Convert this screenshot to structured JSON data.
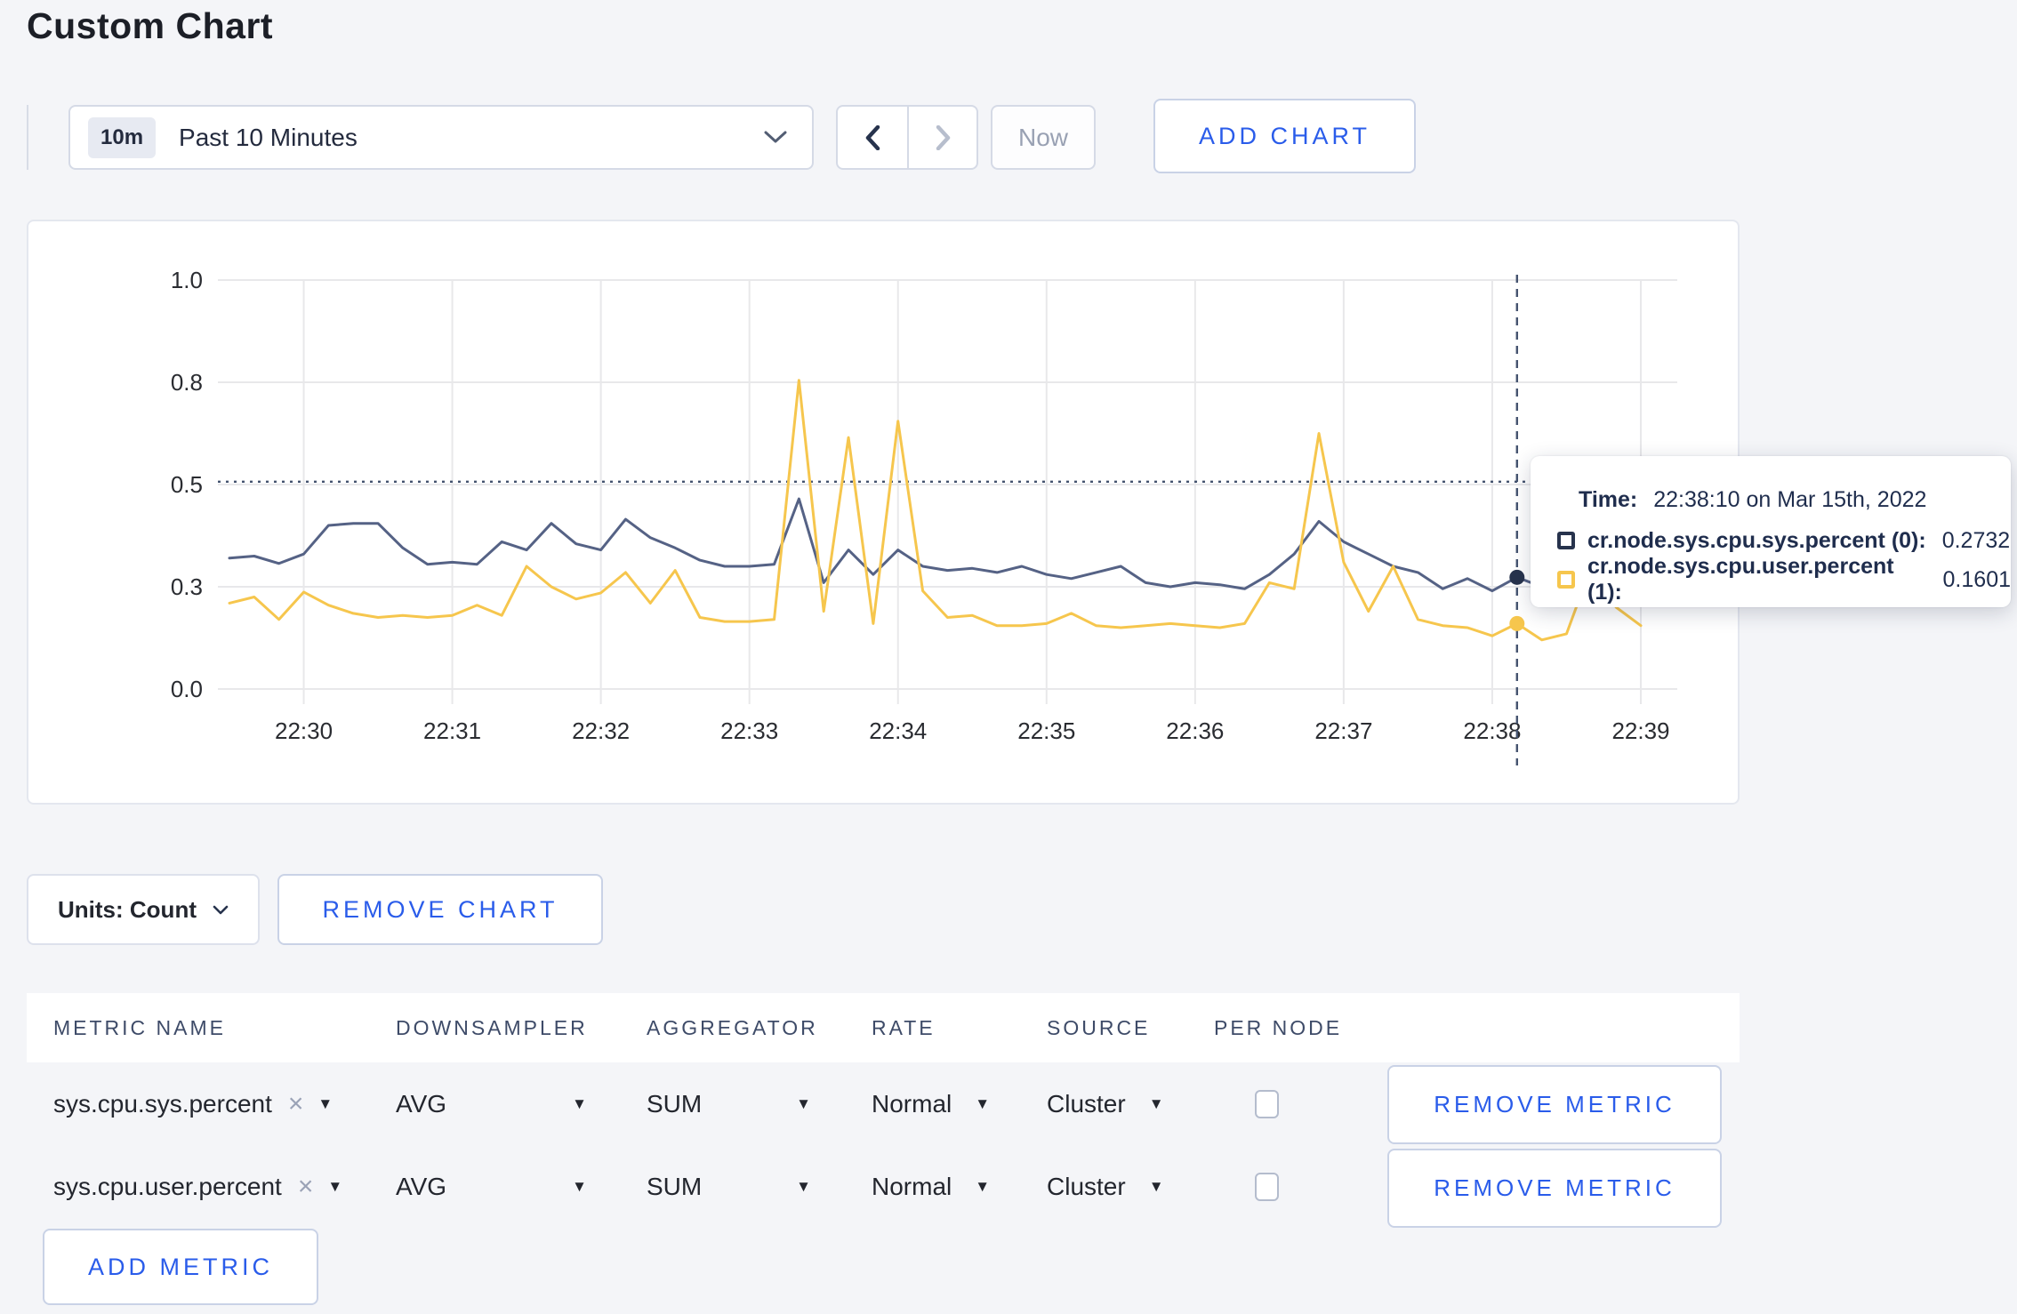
{
  "page": {
    "title": "Custom Chart"
  },
  "colors": {
    "accent": "#2a5cea",
    "navy": "#27334d",
    "series_sys": "#556285",
    "series_user": "#f6c64d",
    "grid": "#e8e8ea"
  },
  "toolbar": {
    "time_badge": "10m",
    "time_label": "Past 10 Minutes",
    "now_label": "Now",
    "add_chart_label": "ADD CHART"
  },
  "chart_controls": {
    "units_label": "Units: Count",
    "remove_chart_label": "REMOVE CHART"
  },
  "tooltip": {
    "time_label": "Time:",
    "time_value": "22:38:10 on Mar 15th, 2022",
    "series": [
      {
        "label": "cr.node.sys.cpu.sys.percent (0):",
        "value": "0.2732",
        "color": "#27334d"
      },
      {
        "label": "cr.node.sys.cpu.user.percent (1):",
        "value": "0.1601",
        "color": "#f6c64d"
      }
    ]
  },
  "chart_data": {
    "type": "line",
    "title": "",
    "xlabel": "",
    "ylabel": "",
    "ylim": [
      0,
      1
    ],
    "grid": true,
    "legend_position": "tooltip",
    "start_time": "22:29:30",
    "interval_seconds": 10,
    "total_seconds": 570,
    "x_tick_labels": [
      "22:30",
      "22:31",
      "22:32",
      "22:33",
      "22:34",
      "22:35",
      "22:36",
      "22:37",
      "22:38",
      "22:39"
    ],
    "x_tick_seconds": [
      30,
      90,
      150,
      210,
      270,
      330,
      390,
      450,
      510,
      570
    ],
    "y_ticks": [
      {
        "value": 0,
        "label": "0.0"
      },
      {
        "value": 0.25,
        "label": "0.3"
      },
      {
        "value": 0.5,
        "label": "0.5"
      },
      {
        "value": 0.75,
        "label": "0.8"
      },
      {
        "value": 1,
        "label": "1.0"
      }
    ],
    "series": [
      {
        "name": "cr.node.sys.cpu.sys.percent",
        "color": "#556285",
        "values": [
          0.32,
          0.325,
          0.307,
          0.33,
          0.4,
          0.405,
          0.405,
          0.345,
          0.305,
          0.31,
          0.305,
          0.36,
          0.34,
          0.405,
          0.355,
          0.34,
          0.415,
          0.37,
          0.345,
          0.315,
          0.3,
          0.3,
          0.305,
          0.465,
          0.26,
          0.34,
          0.28,
          0.34,
          0.3,
          0.29,
          0.295,
          0.285,
          0.3,
          0.28,
          0.27,
          0.285,
          0.3,
          0.26,
          0.25,
          0.26,
          0.255,
          0.245,
          0.28,
          0.33,
          0.41,
          0.36,
          0.33,
          0.3,
          0.285,
          0.245,
          0.27,
          0.24,
          0.2732,
          0.25,
          0.235,
          0.28,
          0.3,
          0.29
        ]
      },
      {
        "name": "cr.node.sys.cpu.user.percent",
        "color": "#f6c64d",
        "values": [
          0.21,
          0.225,
          0.17,
          0.237,
          0.205,
          0.185,
          0.175,
          0.18,
          0.175,
          0.18,
          0.205,
          0.18,
          0.3,
          0.25,
          0.22,
          0.235,
          0.285,
          0.21,
          0.29,
          0.175,
          0.165,
          0.165,
          0.17,
          0.755,
          0.19,
          0.615,
          0.16,
          0.655,
          0.24,
          0.175,
          0.18,
          0.155,
          0.155,
          0.16,
          0.185,
          0.155,
          0.15,
          0.155,
          0.16,
          0.155,
          0.15,
          0.16,
          0.26,
          0.245,
          0.625,
          0.31,
          0.19,
          0.3,
          0.17,
          0.155,
          0.15,
          0.13,
          0.1601,
          0.12,
          0.135,
          0.3,
          0.2,
          0.155
        ]
      }
    ],
    "crosshair": {
      "time": "22:38:10",
      "seconds": 520,
      "value": 0.507,
      "points": [
        {
          "series": 0,
          "value": 0.2732
        },
        {
          "series": 1,
          "value": 0.1601
        }
      ]
    }
  },
  "metrics_table": {
    "columns": [
      "METRIC NAME",
      "DOWNSAMPLER",
      "AGGREGATOR",
      "RATE",
      "SOURCE",
      "PER NODE"
    ],
    "rows": [
      {
        "metric": "sys.cpu.sys.percent",
        "downsampler": "AVG",
        "aggregator": "SUM",
        "rate": "Normal",
        "source": "Cluster",
        "per_node_checked": false,
        "remove_label": "REMOVE METRIC"
      },
      {
        "metric": "sys.cpu.user.percent",
        "downsampler": "AVG",
        "aggregator": "SUM",
        "rate": "Normal",
        "source": "Cluster",
        "per_node_checked": false,
        "remove_label": "REMOVE METRIC"
      }
    ],
    "add_metric_label": "ADD METRIC",
    "remove_x_glyph": "×",
    "caret_glyph": "▼"
  }
}
